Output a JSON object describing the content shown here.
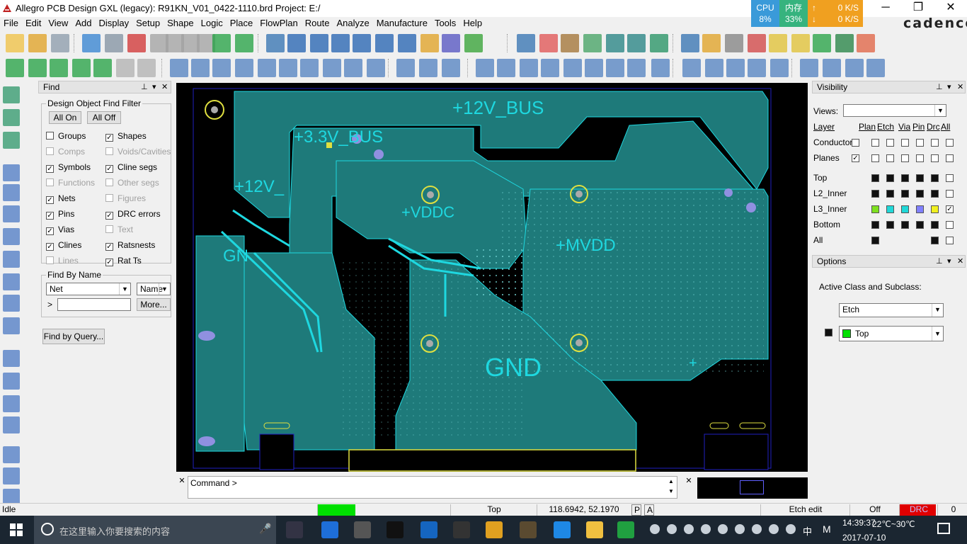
{
  "window": {
    "title": "Allegro PCB Design GXL (legacy): R91KN_V01_0422-1110.brd  Project: E:/",
    "brand": "cadence",
    "controls": [
      "─",
      "❐",
      "✕"
    ]
  },
  "perf": {
    "cpu_label": "CPU",
    "cpu_value": "8%",
    "mem_label": "内存",
    "mem_value": "33%",
    "up": "0 K/S",
    "down": "0 K/S"
  },
  "menu": [
    "File",
    "Edit",
    "View",
    "Add",
    "Display",
    "Setup",
    "Shape",
    "Logic",
    "Place",
    "FlowPlan",
    "Route",
    "Analyze",
    "Manufacture",
    "Tools",
    "Help"
  ],
  "find": {
    "title": "Find",
    "filter_title": "Design Object Find Filter",
    "all_on": "All On",
    "all_off": "All Off",
    "items": [
      {
        "label": "Groups",
        "checked": false,
        "enabled": true
      },
      {
        "label": "Shapes",
        "checked": true,
        "enabled": true
      },
      {
        "label": "Comps",
        "checked": false,
        "enabled": false
      },
      {
        "label": "Voids/Cavities",
        "checked": false,
        "enabled": false
      },
      {
        "label": "Symbols",
        "checked": true,
        "enabled": true
      },
      {
        "label": "Cline segs",
        "checked": true,
        "enabled": true
      },
      {
        "label": "Functions",
        "checked": false,
        "enabled": false
      },
      {
        "label": "Other segs",
        "checked": false,
        "enabled": false
      },
      {
        "label": "Nets",
        "checked": true,
        "enabled": true
      },
      {
        "label": "Figures",
        "checked": false,
        "enabled": false
      },
      {
        "label": "Pins",
        "checked": true,
        "enabled": true
      },
      {
        "label": "DRC errors",
        "checked": true,
        "enabled": true
      },
      {
        "label": "Vias",
        "checked": true,
        "enabled": true
      },
      {
        "label": "Text",
        "checked": false,
        "enabled": false
      },
      {
        "label": "Clines",
        "checked": true,
        "enabled": true
      },
      {
        "label": "Ratsnests",
        "checked": true,
        "enabled": true
      },
      {
        "label": "Lines",
        "checked": false,
        "enabled": false
      },
      {
        "label": "Rat Ts",
        "checked": true,
        "enabled": true
      }
    ],
    "by_name_title": "Find By Name",
    "by_name_type": "Net",
    "by_name_mode": "Name",
    "prompt": ">",
    "name_value": "",
    "more": "More...",
    "by_query": "Find by Query..."
  },
  "board": {
    "labels": {
      "bus12": "+12V_BUS",
      "bus33": "+3.3V_BUS",
      "v12": "+12V_",
      "gnd_left": "GN",
      "vddc": "+VDDC",
      "mvdd": "+MVDD",
      "gnd": "GND",
      "plus": "+"
    },
    "colors": {
      "plane": "#1e7a7a",
      "trace": "#1ed8e0",
      "outline": "#2020c0",
      "via": "#9090e0",
      "gold": "#e0e040"
    }
  },
  "visibility": {
    "title": "Visibility",
    "views_label": "Views:",
    "views_value": "",
    "headers": [
      "Layer",
      "Plan",
      "Etch",
      "Via",
      "Pin",
      "Drc",
      "All"
    ],
    "top_rows": [
      {
        "label": "Conductors"
      },
      {
        "label": "Planes",
        "checked": true
      }
    ],
    "layers": [
      {
        "label": "Top",
        "colors": [
          "#111",
          "#111",
          "#111",
          "#111",
          "#111"
        ],
        "all": false
      },
      {
        "label": "L2_Inner",
        "colors": [
          "#111",
          "#111",
          "#111",
          "#111",
          "#111"
        ],
        "all": false
      },
      {
        "label": "L3_Inner",
        "colors": [
          "#7ee020",
          "#20d8d8",
          "#20d8d8",
          "#8080ff",
          "#f0f020"
        ],
        "all": true
      },
      {
        "label": "Bottom",
        "colors": [
          "#111",
          "#111",
          "#111",
          "#111",
          "#111"
        ],
        "all": false
      },
      {
        "label": "All",
        "colors": [
          "#111"
        ],
        "all": false
      }
    ]
  },
  "options": {
    "title": "Options",
    "active_label": "Active Class and Subclass:",
    "class_value": "Etch",
    "subclass_value": "Top",
    "subclass_color": "#00e000"
  },
  "command": {
    "prompt": "Command >"
  },
  "status": {
    "state": "Idle",
    "layer": "Top",
    "coords": "118.6942, 52.1970",
    "p": "P",
    "a": "A",
    "mode": "Etch edit",
    "off": "Off",
    "drc": "DRC",
    "count": "0"
  },
  "taskbar": {
    "search_placeholder": "在这里输入你要搜索的内容",
    "weather": "22℃~30℃",
    "ime": "中",
    "ime2": "M",
    "date": "2017-07-10",
    "time": "14:39:37"
  }
}
